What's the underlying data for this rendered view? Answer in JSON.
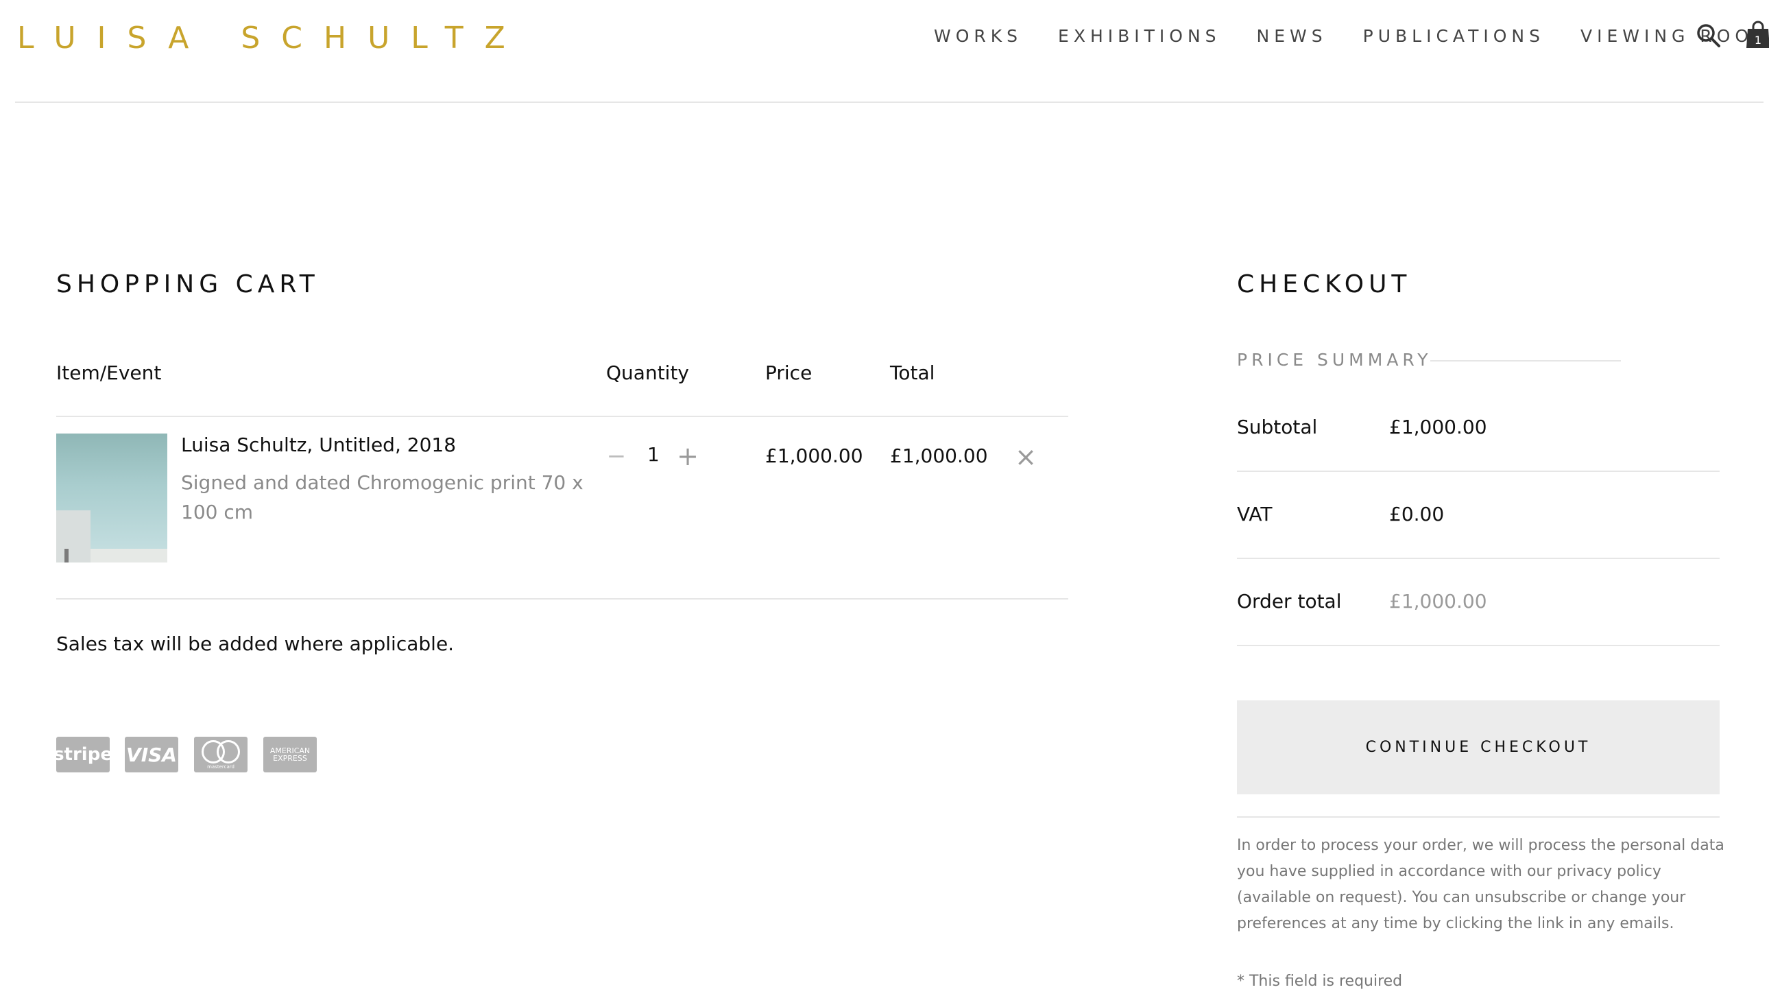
{
  "header": {
    "logo": "LUISA SCHULTZ",
    "nav": [
      "WORKS",
      "EXHIBITIONS",
      "NEWS",
      "PUBLICATIONS",
      "VIEWING ROOM"
    ],
    "cart_count": "1"
  },
  "cart": {
    "title": "SHOPPING CART",
    "columns": {
      "item": "Item/Event",
      "quantity": "Quantity",
      "price": "Price",
      "total": "Total"
    },
    "items": [
      {
        "name": "Luisa Schultz, Untitled, 2018",
        "description": "Signed and dated Chromogenic print 70 x 100 cm",
        "quantity": "1",
        "price": "£1,000.00",
        "total": "£1,000.00"
      }
    ],
    "tax_note": "Sales tax will be added where applicable.",
    "payment_methods": {
      "stripe": "stripe",
      "visa": "VISA",
      "mastercard": "mastercard",
      "amex_line1": "AMERICAN",
      "amex_line2": "EXPRESS"
    }
  },
  "checkout": {
    "title": "CHECKOUT",
    "summary_label": "PRICE SUMMARY",
    "subtotal_label": "Subtotal",
    "subtotal_value": "£1,000.00",
    "vat_label": "VAT",
    "vat_value": "£0.00",
    "order_total_label": "Order total",
    "order_total_value": "£1,000.00",
    "continue_label": "CONTINUE CHECKOUT",
    "privacy_text": "In order to process your order, we will process the personal data you have supplied in accordance with our privacy policy (available on request). You can unsubscribe or change your preferences at any time by clicking the link in any emails.",
    "required_note": "* This field is required"
  }
}
